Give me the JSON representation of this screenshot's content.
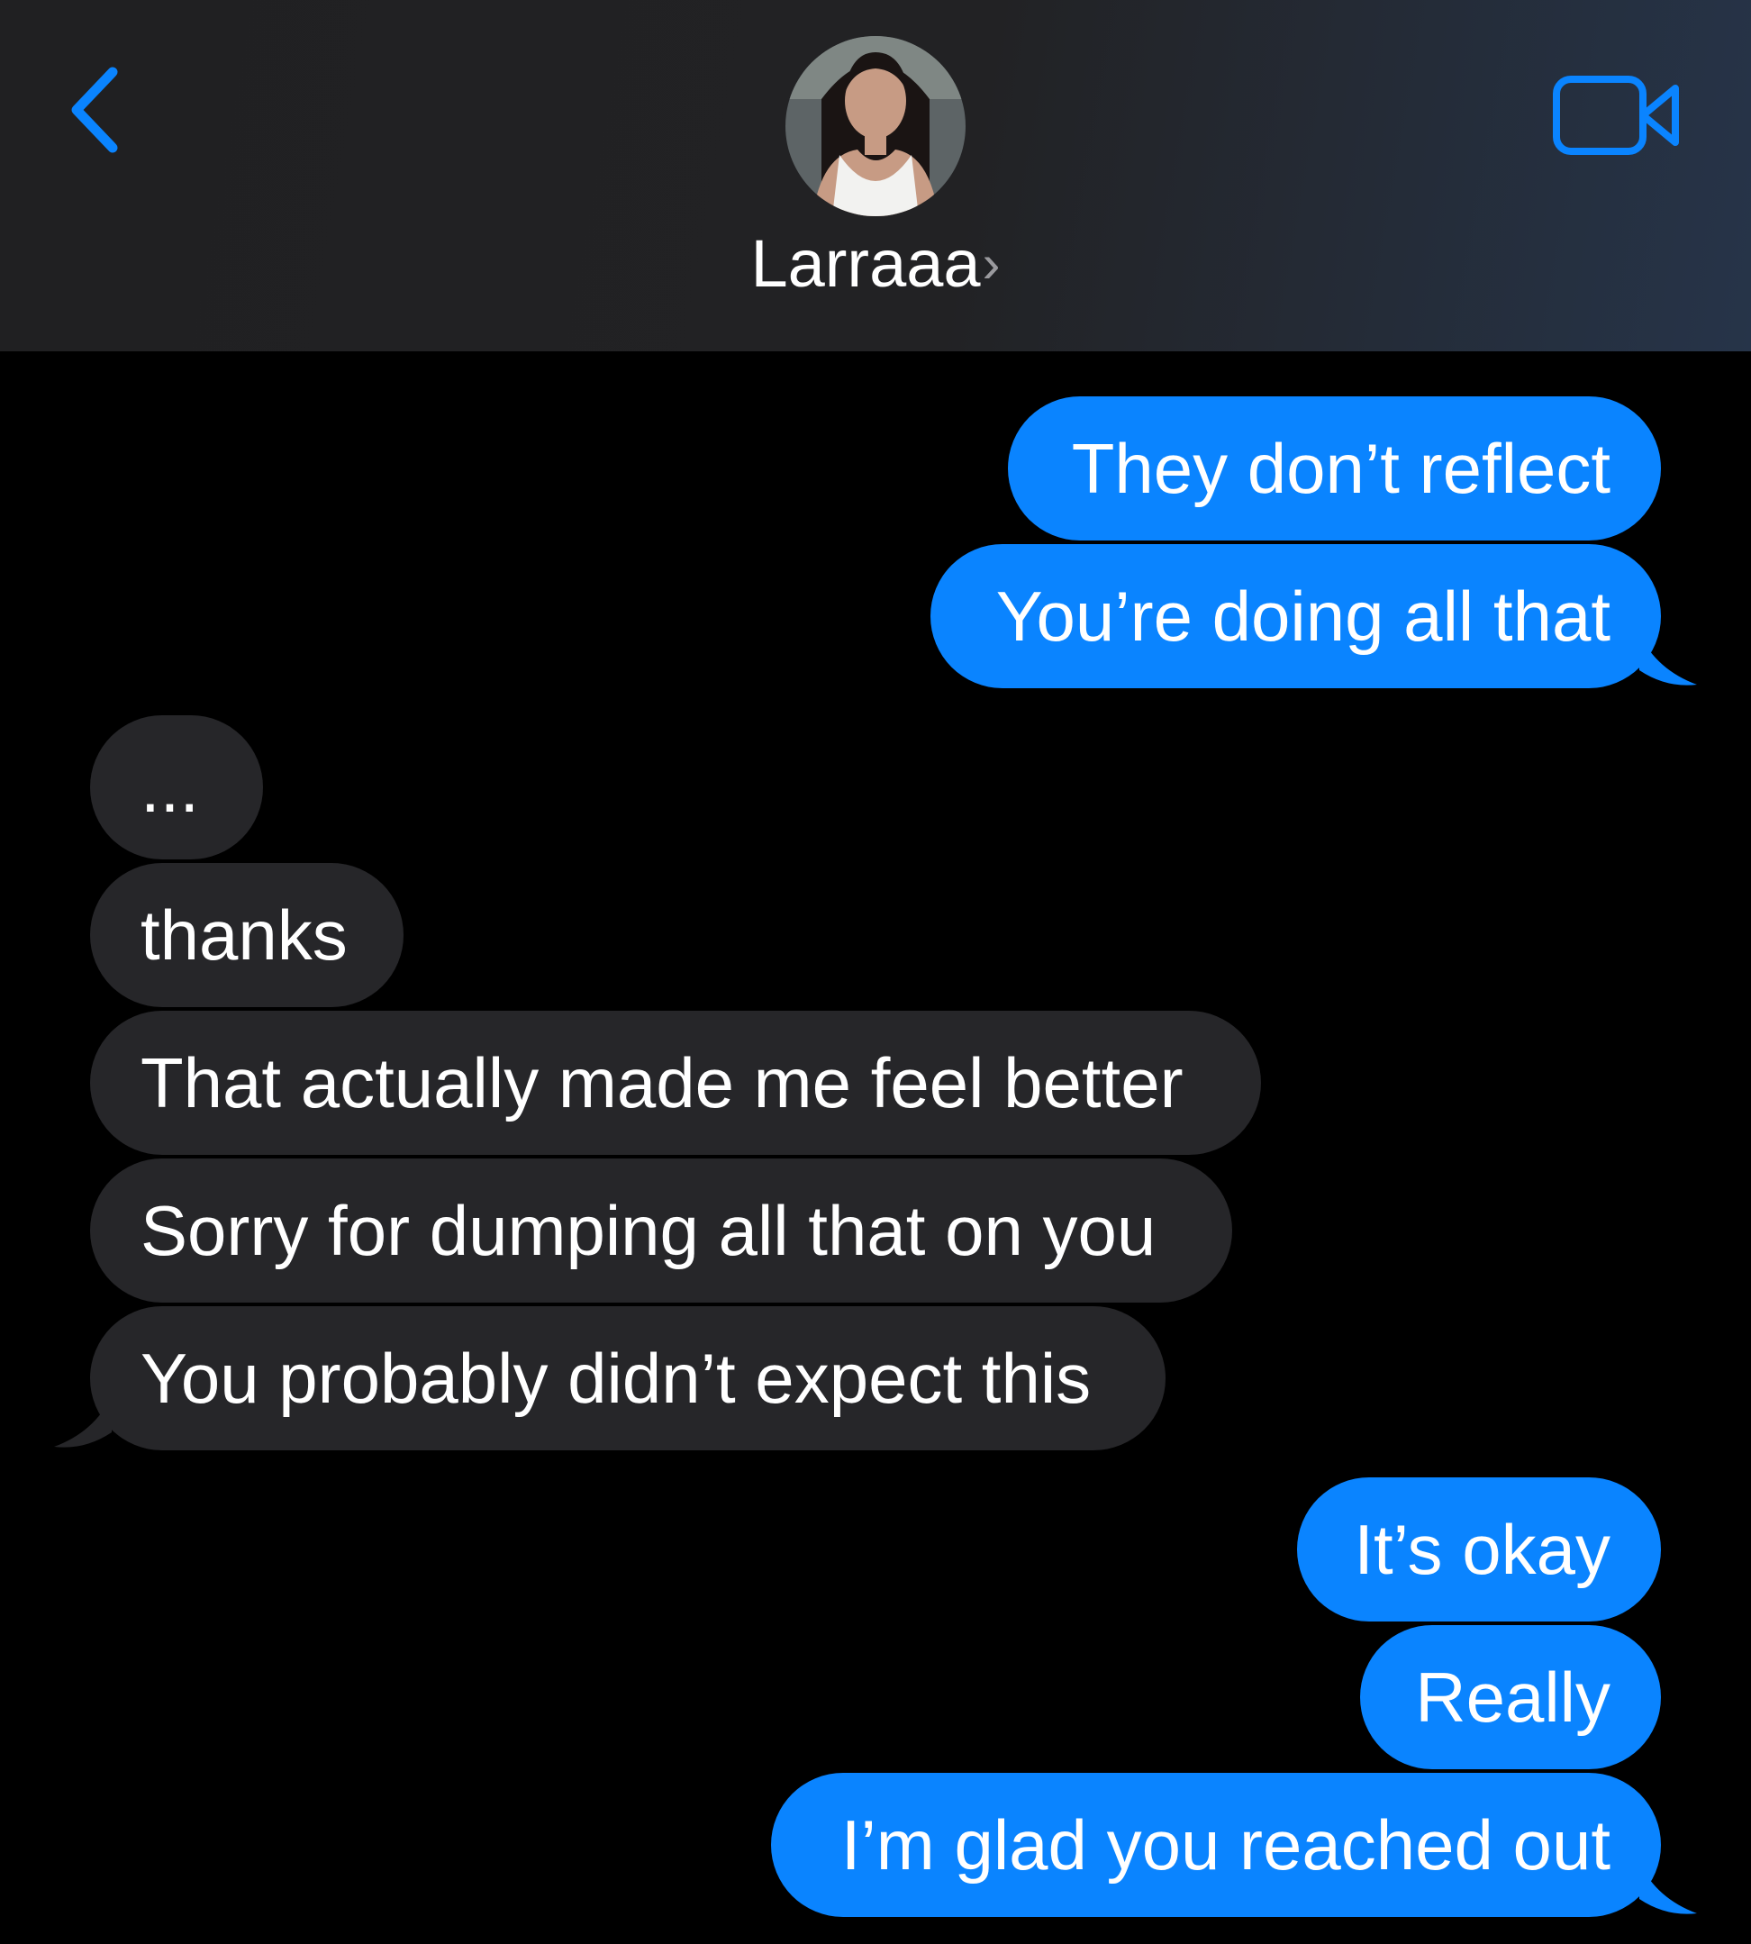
{
  "colors": {
    "accent_blue": "#0a84ff",
    "outgoing_bubble": "#0a84ff",
    "incoming_bubble": "#262629",
    "header_bg": "#202022",
    "background": "#000000"
  },
  "header": {
    "back_icon": "chevron-left-icon",
    "avatar_icon": "contact-avatar",
    "contact_name": "Larraaa",
    "name_chevron": "›",
    "video_icon": "video-camera-icon"
  },
  "messages": [
    {
      "direction": "outgoing",
      "text": "They don’t reflect"
    },
    {
      "direction": "outgoing",
      "text": "You’re doing all that"
    },
    {
      "direction": "incoming",
      "text": "..."
    },
    {
      "direction": "incoming",
      "text": "thanks"
    },
    {
      "direction": "incoming",
      "text": "That actually made me feel better"
    },
    {
      "direction": "incoming",
      "text": "Sorry for dumping all that on you"
    },
    {
      "direction": "incoming",
      "text": "You probably didn’t expect this"
    },
    {
      "direction": "outgoing",
      "text": "It’s okay"
    },
    {
      "direction": "outgoing",
      "text": "Really"
    },
    {
      "direction": "outgoing",
      "text": "I’m glad you reached out"
    }
  ]
}
